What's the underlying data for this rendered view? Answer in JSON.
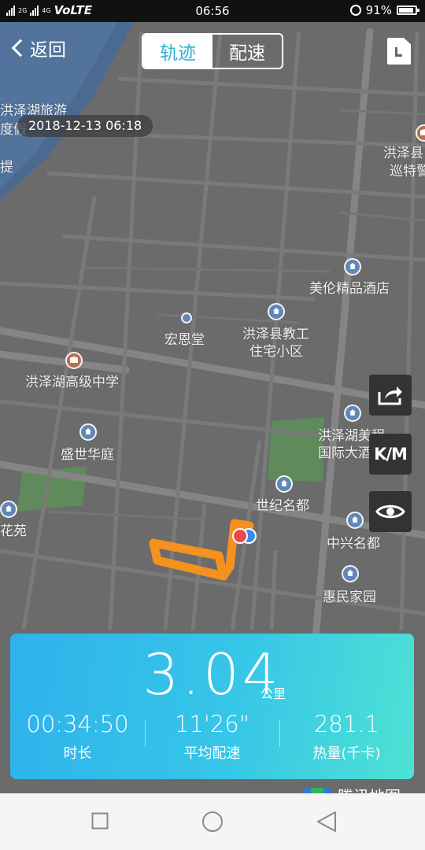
{
  "status_bar": {
    "network_left": "2G",
    "network_right": "4G",
    "volte": "VoLTE",
    "time": "06:56",
    "battery": "91%"
  },
  "header": {
    "back_label": "返回",
    "tabs": [
      "轨迹",
      "配速"
    ],
    "active_tab": 0
  },
  "timestamp": "2018-12-13 06:18",
  "map": {
    "labels": {
      "lake_tourism_1": "洪泽湖旅游",
      "lake_tourism_2": "度假",
      "lake_ti": "提",
      "gov_1": "洪泽县",
      "gov_2": "巡特警",
      "hotel_meilun": "美伦精品酒店",
      "hongendang": "宏恩堂",
      "teacher_housing_1": "洪泽县教工",
      "teacher_housing_2": "住宅小区",
      "high_school": "洪泽湖高级中学",
      "shengshi": "盛世华庭",
      "intl_hotel_1": "洪泽湖美程",
      "intl_hotel_2": "国际大酒",
      "shiji": "世纪名都",
      "huayuan": "花苑",
      "zhongxing": "中兴名都",
      "huimin": "惠民家园"
    }
  },
  "tools": {
    "share_icon": "share-icon",
    "km_label": "K/M",
    "eye_icon": "eye-icon"
  },
  "stats": {
    "distance": "3.04",
    "distance_unit": "公里",
    "duration_value": "00:34:50",
    "duration_label": "时长",
    "pace_value": "11'26\"",
    "pace_label": "平均配速",
    "calories_value": "281.1",
    "calories_label": "热量(千卡)"
  },
  "map_logo": "腾讯地图",
  "colors": {
    "accent": "#2fb0d0",
    "track": "#f5911e",
    "card_start": "#2fb2ec",
    "card_end": "#4de2d3"
  }
}
